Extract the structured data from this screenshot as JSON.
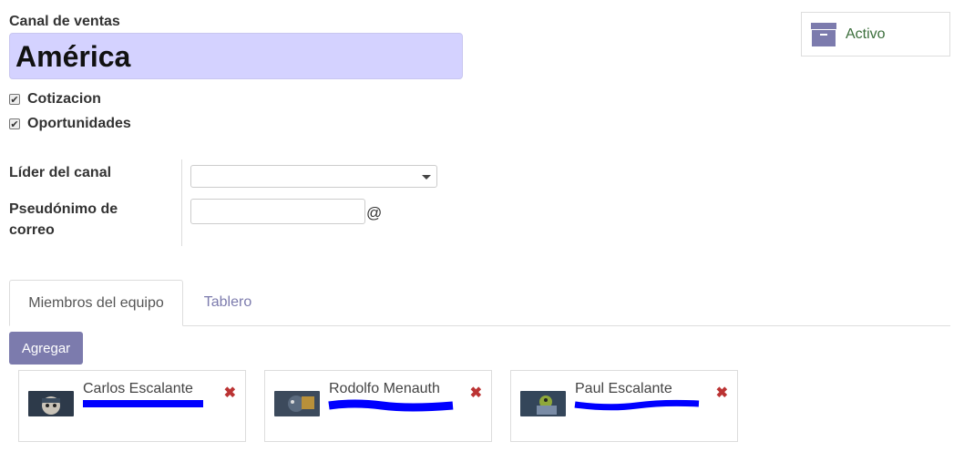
{
  "form": {
    "name_label": "Canal de ventas",
    "name_value": "América",
    "checks": [
      {
        "label": "Cotizacion",
        "checked": true
      },
      {
        "label": "Oportunidades",
        "checked": true
      }
    ],
    "leader_label": "Líder del canal",
    "leader_value": "",
    "alias_label_line1": "Pseudónimo de",
    "alias_label_line2": "correo",
    "alias_value": "",
    "alias_suffix": "@"
  },
  "status": {
    "label": "Activo",
    "icon": "archive-icon"
  },
  "tabs": [
    {
      "label": "Miembros del equipo",
      "active": true
    },
    {
      "label": "Tablero",
      "active": false
    }
  ],
  "actions": {
    "add_label": "Agregar"
  },
  "members": [
    {
      "name": "Carlos Escalante"
    },
    {
      "name": "Rodolfo Menauth"
    },
    {
      "name": "Paul Escalante"
    }
  ],
  "colors": {
    "accent": "#7c7bad",
    "title_bg": "#d4d2ff",
    "active_text": "#3b6e3b",
    "redaction": "#0000ff",
    "remove": "#b33333"
  }
}
